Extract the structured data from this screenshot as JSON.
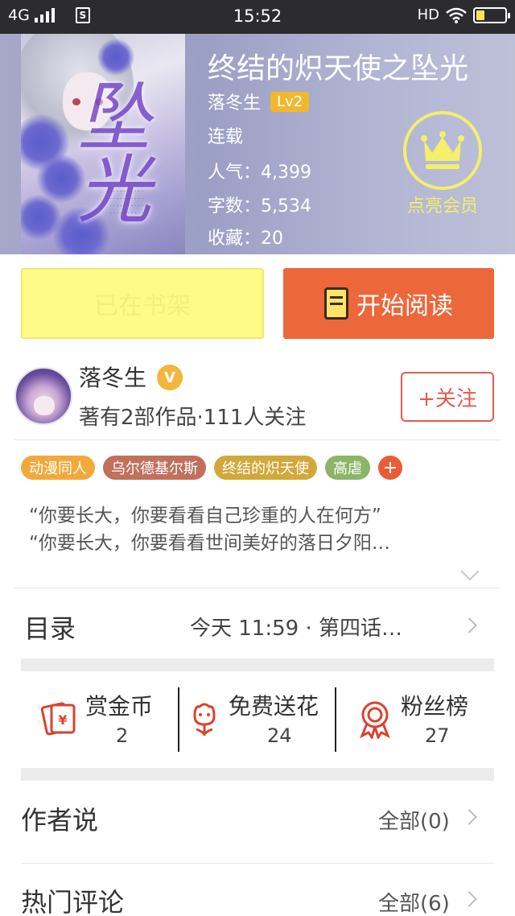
{
  "status_bar": {
    "network": "4G",
    "sim": "S",
    "time": "15:52",
    "hd": "HD"
  },
  "book": {
    "title": "终结的炽天使之坠光",
    "author": "落冬生",
    "level": "Lv2",
    "status": "连载",
    "popularity_label": "人气",
    "popularity": "4,399",
    "words_label": "字数",
    "words": "5,534",
    "favorites_label": "收藏",
    "favorites": "20",
    "cover_calligraphy": "坠光"
  },
  "vip": {
    "label": "点亮会员",
    "icon": "crown-icon",
    "color": "#f5ef6a"
  },
  "actions": {
    "shelf_label": "已在书架",
    "read_label": "开始阅读",
    "read_color": "#ec673a",
    "shelf_color": "#fefb86"
  },
  "author": {
    "name": "落冬生",
    "verified_badge": "V",
    "stats": "著有2部作品·111人关注",
    "follow_label": "+关注"
  },
  "tags": [
    {
      "label": "动漫同人",
      "color": "#f2a93b"
    },
    {
      "label": "乌尔德基尔斯",
      "color": "#c0705c"
    },
    {
      "label": "终结的炽天使",
      "color": "#d2a83a"
    },
    {
      "label": "高虐",
      "color": "#8cb567"
    }
  ],
  "tag_more": "+",
  "summary": {
    "line1": "“你要长大，你要看看自己珍重的人在何方”",
    "line2": "“你要长大，你要看看世间美好的落日夕阳…"
  },
  "catalog": {
    "label": "目录",
    "latest": "今天 11:59 · 第四话…"
  },
  "stats": [
    {
      "label": "赏金币",
      "value": "2",
      "icon": "red-envelope-icon"
    },
    {
      "label": "免费送花",
      "value": "24",
      "icon": "flower-icon"
    },
    {
      "label": "粉丝榜",
      "value": "27",
      "icon": "medal-icon"
    }
  ],
  "author_says": {
    "label": "作者说",
    "link": "全部(0)"
  },
  "hot_comments": {
    "label": "热门评论",
    "link": "全部(6)"
  }
}
